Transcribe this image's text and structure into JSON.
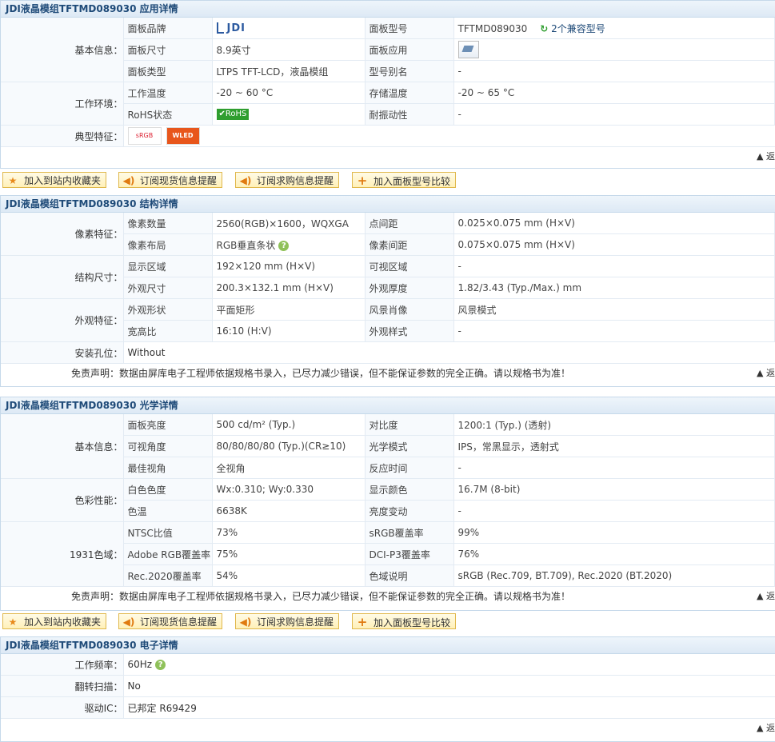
{
  "app": {
    "section_title": "JDI液晶模组TFTMD089030 应用详情",
    "groups": {
      "basic": "基本信息：",
      "env": "工作环境：",
      "feature": "典型特征："
    },
    "rows": {
      "brand_label": "面板品牌",
      "brand_value": "JDI",
      "model_label": "面板型号",
      "model_value": "TFTMD089030",
      "compat": "2个兼容型号",
      "size_label": "面板尺寸",
      "size_value": "8.9英寸",
      "application_label": "面板应用",
      "type_label": "面板类型",
      "type_value": "LTPS TFT-LCD，液晶模组",
      "alias_label": "型号别名",
      "alias_value": "-",
      "optemp_label": "工作温度",
      "optemp_value": "-20 ~ 60 °C",
      "sttemp_label": "存储温度",
      "sttemp_value": "-20 ~ 65 °C",
      "rohs_label": "RoHS状态",
      "rohs_value": "RoHS",
      "vib_label": "耐振动性",
      "vib_value": "-",
      "srgb_badge": "sRGB",
      "wled_badge": "WLED"
    },
    "more": "▲ 返"
  },
  "actions": {
    "fav": "加入到站内收藏夹",
    "stock": "订阅现货信息提醒",
    "buy": "订阅求购信息提醒",
    "compare": "加入面板型号比较"
  },
  "struct": {
    "section_title": "JDI液晶模组TFTMD089030 结构详情",
    "groups": {
      "pixel": "像素特征：",
      "size": "结构尺寸：",
      "look": "外观特征：",
      "mount": "安装孔位："
    },
    "rows": {
      "pixnum_label": "像素数量",
      "pixnum_value": "2560(RGB)×1600，WQXGA",
      "pitch_label": "点间距",
      "pitch_value": "0.025×0.075 mm (H×V)",
      "layout_label": "像素布局",
      "layout_value": "RGB垂直条状",
      "pixpitch_label": "像素间距",
      "pixpitch_value": "0.075×0.075 mm (H×V)",
      "disp_label": "显示区域",
      "disp_value": "192×120 mm (H×V)",
      "view_label": "可视区域",
      "view_value": "-",
      "outline_label": "外观尺寸",
      "outline_value": "200.3×132.1 mm (H×V)",
      "thick_label": "外观厚度",
      "thick_value": "1.82/3.43 (Typ./Max.) mm",
      "shape_label": "外观形状",
      "shape_value": "平面矩形",
      "orient_label": "风景肖像",
      "orient_value": "风景模式",
      "ratio_label": "宽高比",
      "ratio_value": "16:10 (H:V)",
      "style_label": "外观样式",
      "style_value": "-",
      "mount_value": "Without"
    },
    "disclaimer": "免责声明：数据由屏库电子工程师依据规格书录入，已尽力减少错误，但不能保证参数的完全正确。请以规格书为准！",
    "more": "▲ 返"
  },
  "optic": {
    "section_title": "JDI液晶模组TFTMD089030 光学详情",
    "groups": {
      "basic": "基本信息：",
      "color": "色彩性能：",
      "gamut": "1931色域："
    },
    "rows": {
      "bright_label": "面板亮度",
      "bright_value": "500 cd/m² (Typ.)",
      "contrast_label": "对比度",
      "contrast_value": "1200:1 (Typ.) (透射)",
      "angle_label": "可视角度",
      "angle_value": "80/80/80/80 (Typ.)(CR≥10)",
      "mode_label": "光学模式",
      "mode_value": "IPS，常黑显示，透射式",
      "best_label": "最佳视角",
      "best_value": "全视角",
      "resp_label": "反应时间",
      "resp_value": "-",
      "white_label": "白色色度",
      "white_value": "Wx:0.310; Wy:0.330",
      "colors_label": "显示颜色",
      "colors_value": "16.7M (8-bit)",
      "temp_label": "色温",
      "temp_value": "6638K",
      "bvar_label": "亮度变动",
      "bvar_value": "-",
      "ntsc_label": "NTSC比值",
      "ntsc_value": "73%",
      "srgb_label": "sRGB覆盖率",
      "srgb_value": "99%",
      "adobe_label": "Adobe RGB覆盖率",
      "adobe_value": "75%",
      "dci_label": "DCI-P3覆盖率",
      "dci_value": "76%",
      "rec_label": "Rec.2020覆盖率",
      "rec_value": "54%",
      "gnote_label": "色域说明",
      "gnote_value": "sRGB (Rec.709, BT.709), Rec.2020 (BT.2020)"
    },
    "disclaimer": "免责声明：数据由屏库电子工程师依据规格书录入，已尽力减少错误，但不能保证参数的完全正确。请以规格书为准！",
    "more": "▲ 返"
  },
  "elec": {
    "section_title": "JDI液晶模组TFTMD089030 电子详情",
    "rows": {
      "freq_label": "工作频率：",
      "freq_value": "60Hz",
      "scan_label": "翻转扫描：",
      "scan_value": "No",
      "ic_label": "驱动IC：",
      "ic_value": "已邦定 R69429"
    },
    "more": "▲ 返"
  }
}
